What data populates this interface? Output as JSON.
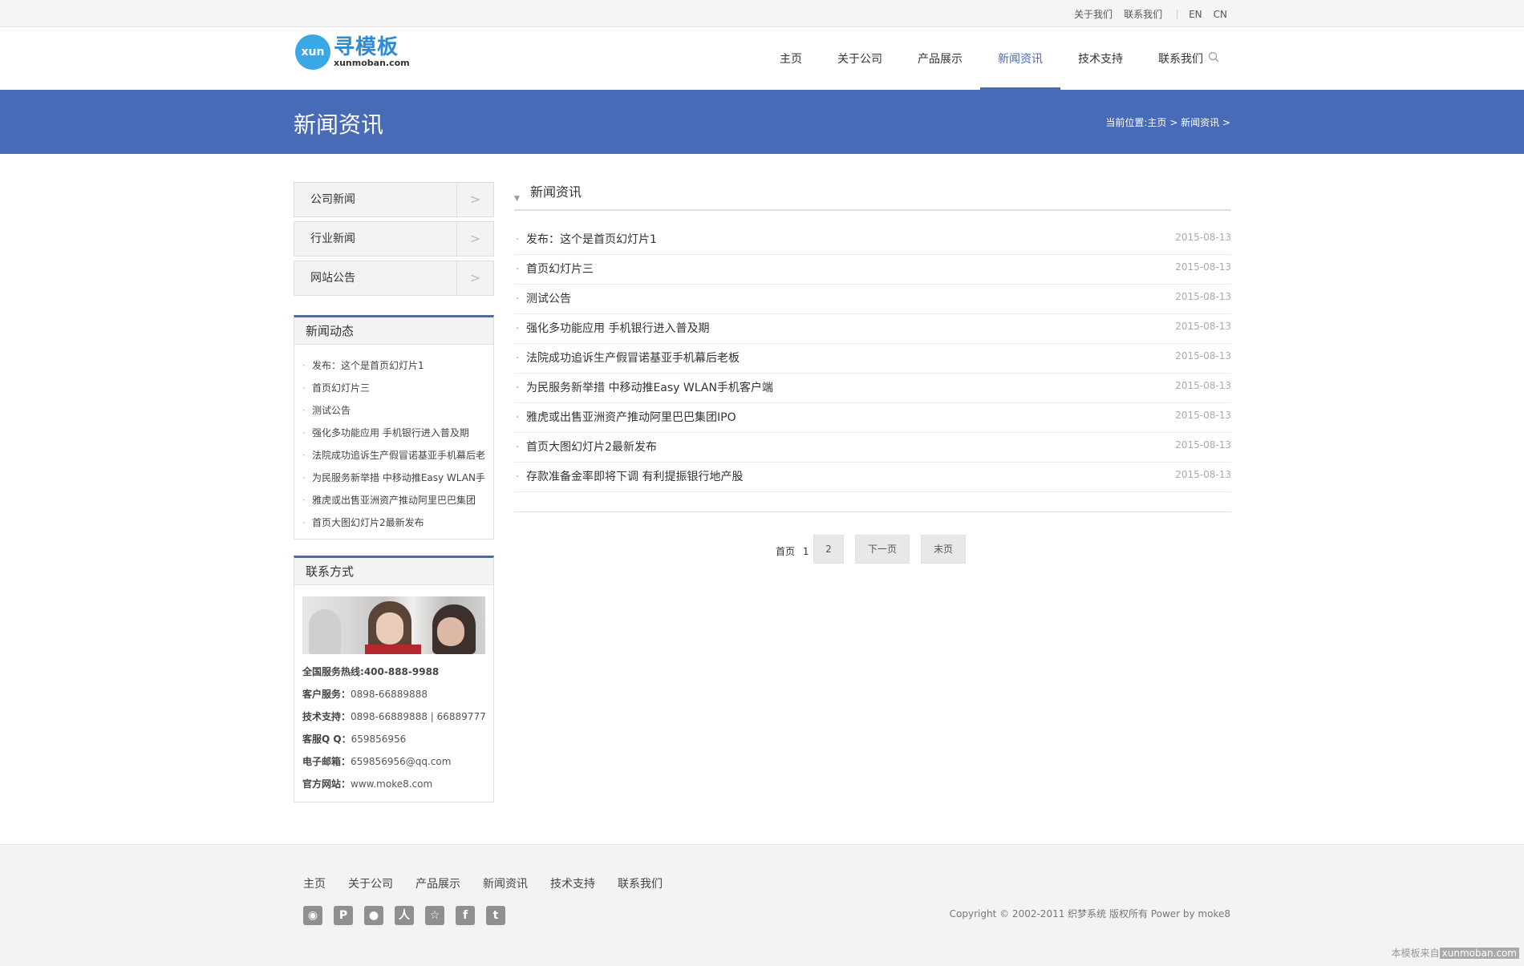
{
  "topbar": {
    "links": [
      "关于我们",
      "联系我们"
    ],
    "langs": [
      "EN",
      "CN"
    ]
  },
  "logo": {
    "badge": "xun",
    "name": "寻模板",
    "domain": "xunmoban.com"
  },
  "nav": {
    "items": [
      "主页",
      "关于公司",
      "产品展示",
      "新闻资讯",
      "技术支持",
      "联系我们"
    ],
    "active": "新闻资讯",
    "search_icon": "search-icon"
  },
  "banner": {
    "title": "新闻资讯",
    "breadcrumb": "当前位置:主页 > 新闻资讯 >"
  },
  "sidebar": {
    "categories": [
      "公司新闻",
      "行业新闻",
      "网站公告"
    ],
    "arrow": ">",
    "news_box_title": "新闻动态",
    "news": [
      "发布：这个是首页幻灯片1",
      "首页幻灯片三",
      "测试公告",
      "强化多功能应用 手机银行进入普及期",
      "法院成功追诉生产假冒诺基亚手机幕后老",
      "为民服务新举措 中移动推Easy WLAN手",
      "雅虎或出售亚洲资产推动阿里巴巴集团",
      "首页大图幻灯片2最新发布"
    ],
    "contact_title": "联系方式",
    "contact": {
      "hotline_label": "全国服务热线:",
      "hotline": "400-888-9988",
      "service_label": "客户服务：",
      "service": "0898-66889888",
      "tech_label": "技术支持：",
      "tech": "0898-66889888 | 66889777",
      "qq_label": "客服Q Q：",
      "qq": "659856956",
      "email_label": "电子邮箱：",
      "email": "659856956@qq.com",
      "site_label": "官方网站：",
      "site": "www.moke8.com"
    }
  },
  "main": {
    "title": "新闻资讯",
    "news": [
      {
        "title": "发布：这个是首页幻灯片1",
        "date": "2015-08-13"
      },
      {
        "title": "首页幻灯片三",
        "date": "2015-08-13"
      },
      {
        "title": "测试公告",
        "date": "2015-08-13"
      },
      {
        "title": "强化多功能应用 手机银行进入普及期",
        "date": "2015-08-13"
      },
      {
        "title": "法院成功追诉生产假冒诺基亚手机幕后老板",
        "date": "2015-08-13"
      },
      {
        "title": "为民服务新举措 中移动推Easy WLAN手机客户端",
        "date": "2015-08-13"
      },
      {
        "title": "雅虎或出售亚洲资产推动阿里巴巴集团IPO",
        "date": "2015-08-13"
      },
      {
        "title": "首页大图幻灯片2最新发布",
        "date": "2015-08-13"
      },
      {
        "title": "存款准备金率即将下调 有利提振银行地产股",
        "date": "2015-08-13"
      }
    ],
    "pager": {
      "first": "首页",
      "current": "1",
      "page2": "2",
      "next": "下一页",
      "last": "末页"
    }
  },
  "footer": {
    "nav": [
      "主页",
      "关于公司",
      "产品展示",
      "新闻资讯",
      "技术支持",
      "联系我们"
    ],
    "social_icons": [
      "weibo-icon",
      "pinterest-icon",
      "chat-icon",
      "renren-icon",
      "star-icon",
      "facebook-icon",
      "twitter-icon"
    ],
    "copyright": "Copyright © 2002-2011 织梦系统 版权所有 Power by moke8",
    "watermark_text": "本模板来自",
    "watermark_site": "xunmoban.com"
  }
}
